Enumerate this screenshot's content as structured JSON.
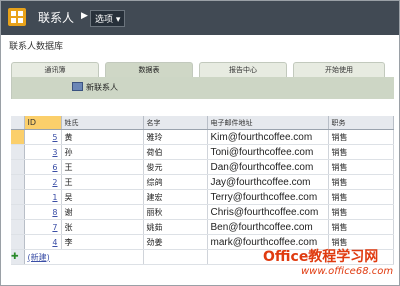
{
  "titlebar": {
    "app_title": "联系人",
    "options_label": "选项"
  },
  "page_title": "联系人数据库",
  "tabs": [
    {
      "label": "通讯簿"
    },
    {
      "label": "数据表"
    },
    {
      "label": "报告中心"
    },
    {
      "label": "开始使用"
    }
  ],
  "command_bar": {
    "new_contact_label": "新联系人"
  },
  "grid": {
    "headers": [
      "ID",
      "姓氏",
      "名字",
      "电子邮件地址",
      "职务"
    ],
    "rows": [
      {
        "id": "5",
        "last": "黄",
        "first": "雅玲",
        "email": "Kim@fourthcoffee.com",
        "title": "销售"
      },
      {
        "id": "3",
        "last": "孙",
        "first": "荷伯",
        "email": "Toni@fourthcoffee.com",
        "title": "销售"
      },
      {
        "id": "6",
        "last": "王",
        "first": "俊元",
        "email": "Dan@fourthcoffee.com",
        "title": "销售"
      },
      {
        "id": "2",
        "last": "王",
        "first": "综鸽",
        "email": "Jay@fourthcoffee.com",
        "title": "销售"
      },
      {
        "id": "1",
        "last": "吴",
        "first": "建宏",
        "email": "Terry@fourthcoffee.com",
        "title": "销售"
      },
      {
        "id": "8",
        "last": "谢",
        "first": "丽秋",
        "email": "Chris@fourthcoffee.com",
        "title": "销售"
      },
      {
        "id": "7",
        "last": "张",
        "first": "姚茹",
        "email": "Ben@fourthcoffee.com",
        "title": "销售"
      },
      {
        "id": "4",
        "last": "李",
        "first": "劲姜",
        "email": "mark@fourthcoffee.com",
        "title": "销售"
      }
    ],
    "new_row_label": "(新建)"
  },
  "watermark": {
    "line1": "Office教程学习网",
    "line2": "www.office68.com"
  },
  "colors": {
    "titlebar_bg": "#414a54",
    "tab_active_bg": "#cfd7c6",
    "id_header_bg": "#fbcf6b",
    "watermark": "#e03b10"
  }
}
